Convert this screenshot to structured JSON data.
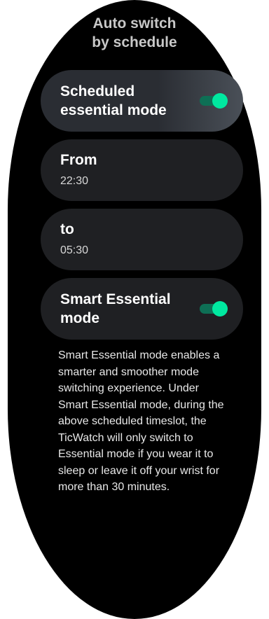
{
  "title": "Auto switch by schedule",
  "items": [
    {
      "label": "Scheduled essential mode",
      "toggle_on": true
    },
    {
      "label": "From",
      "value": "22:30"
    },
    {
      "label": "to",
      "value": "05:30"
    },
    {
      "label": "Smart Essential mode",
      "toggle_on": true
    }
  ],
  "description": "Smart Essential mode enables a smarter and smoother mode switching experience. Under Smart Essential mode, during the above scheduled timeslot, the TicWatch will only switch to Essential mode if you wear it to sleep or leave it off your wrist for more than 30 minutes.",
  "colors": {
    "toggle_on": "#00e9a0",
    "toggle_track": "#0e6f55",
    "card_background": "#1f2023"
  }
}
